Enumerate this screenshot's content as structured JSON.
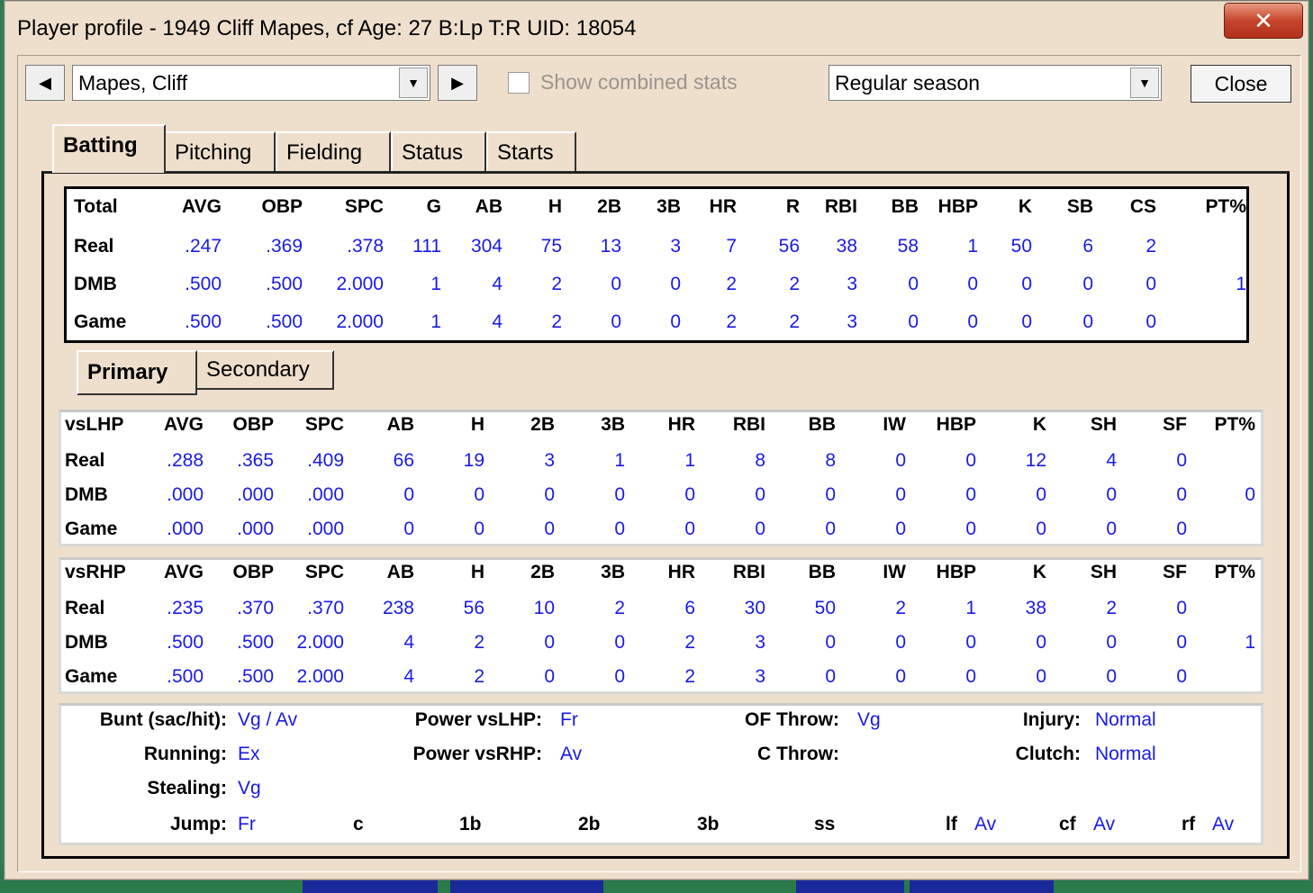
{
  "window": {
    "title": "Player profile - 1949 Cliff Mapes, cf  Age: 27  B:Lp  T:R  UID: 18054",
    "close_glyph": "✕"
  },
  "toolbar": {
    "player": "Mapes, Cliff",
    "show_combined_label": "Show combined stats",
    "season": "Regular season",
    "close_label": "Close",
    "prev_glyph": "◀",
    "next_glyph": "▶",
    "dropdown_glyph": "▼"
  },
  "tabs": [
    "Batting",
    "Pitching",
    "Fielding",
    "Status",
    "Starts"
  ],
  "subtabs": [
    "Primary",
    "Secondary"
  ],
  "totals": {
    "headers": [
      "Total",
      "AVG",
      "OBP",
      "SPC",
      "G",
      "AB",
      "H",
      "2B",
      "3B",
      "HR",
      "R",
      "RBI",
      "BB",
      "HBP",
      "K",
      "SB",
      "CS",
      "PT%"
    ],
    "rows": [
      [
        "Real",
        ".247",
        ".369",
        ".378",
        "111",
        "304",
        "75",
        "13",
        "3",
        "7",
        "56",
        "38",
        "58",
        "1",
        "50",
        "6",
        "2",
        ""
      ],
      [
        "DMB",
        ".500",
        ".500",
        "2.000",
        "1",
        "4",
        "2",
        "0",
        "0",
        "2",
        "2",
        "3",
        "0",
        "0",
        "0",
        "0",
        "0",
        "1"
      ],
      [
        "Game",
        ".500",
        ".500",
        "2.000",
        "1",
        "4",
        "2",
        "0",
        "0",
        "2",
        "2",
        "3",
        "0",
        "0",
        "0",
        "0",
        "0",
        ""
      ]
    ]
  },
  "vslhp": {
    "headers": [
      "vsLHP",
      "AVG",
      "OBP",
      "SPC",
      "AB",
      "H",
      "2B",
      "3B",
      "HR",
      "RBI",
      "BB",
      "IW",
      "HBP",
      "K",
      "SH",
      "SF",
      "PT%"
    ],
    "rows": [
      [
        "Real",
        ".288",
        ".365",
        ".409",
        "66",
        "19",
        "3",
        "1",
        "1",
        "8",
        "8",
        "0",
        "0",
        "12",
        "4",
        "0",
        ""
      ],
      [
        "DMB",
        ".000",
        ".000",
        ".000",
        "0",
        "0",
        "0",
        "0",
        "0",
        "0",
        "0",
        "0",
        "0",
        "0",
        "0",
        "0",
        "0"
      ],
      [
        "Game",
        ".000",
        ".000",
        ".000",
        "0",
        "0",
        "0",
        "0",
        "0",
        "0",
        "0",
        "0",
        "0",
        "0",
        "0",
        "0",
        ""
      ]
    ]
  },
  "vsrhp": {
    "headers": [
      "vsRHP",
      "AVG",
      "OBP",
      "SPC",
      "AB",
      "H",
      "2B",
      "3B",
      "HR",
      "RBI",
      "BB",
      "IW",
      "HBP",
      "K",
      "SH",
      "SF",
      "PT%"
    ],
    "rows": [
      [
        "Real",
        ".235",
        ".370",
        ".370",
        "238",
        "56",
        "10",
        "2",
        "6",
        "30",
        "50",
        "2",
        "1",
        "38",
        "2",
        "0",
        ""
      ],
      [
        "DMB",
        ".500",
        ".500",
        "2.000",
        "4",
        "2",
        "0",
        "0",
        "2",
        "3",
        "0",
        "0",
        "0",
        "0",
        "0",
        "0",
        "1"
      ],
      [
        "Game",
        ".500",
        ".500",
        "2.000",
        "4",
        "2",
        "0",
        "0",
        "2",
        "3",
        "0",
        "0",
        "0",
        "0",
        "0",
        "0",
        ""
      ]
    ]
  },
  "ratings": {
    "bunt_label": "Bunt (sac/hit):",
    "bunt": "Vg / Av",
    "running_label": "Running:",
    "running": "Ex",
    "stealing_label": "Stealing:",
    "stealing": "Vg",
    "jump_label": "Jump:",
    "jump": "Fr",
    "power_l_label": "Power vsLHP:",
    "power_l": "Fr",
    "power_r_label": "Power vsRHP:",
    "power_r": "Av",
    "of_throw_label": "OF Throw:",
    "of_throw": "Vg",
    "c_throw_label": "C Throw:",
    "c_throw": "",
    "injury_label": "Injury:",
    "injury": "Normal",
    "clutch_label": "Clutch:",
    "clutch": "Normal",
    "positions": {
      "c": "c",
      "1b": "1b",
      "2b": "2b",
      "3b": "3b",
      "ss": "ss",
      "lf": "lf",
      "lf_val": "Av",
      "cf": "cf",
      "cf_val": "Av",
      "rf": "rf",
      "rf_val": "Av"
    }
  }
}
